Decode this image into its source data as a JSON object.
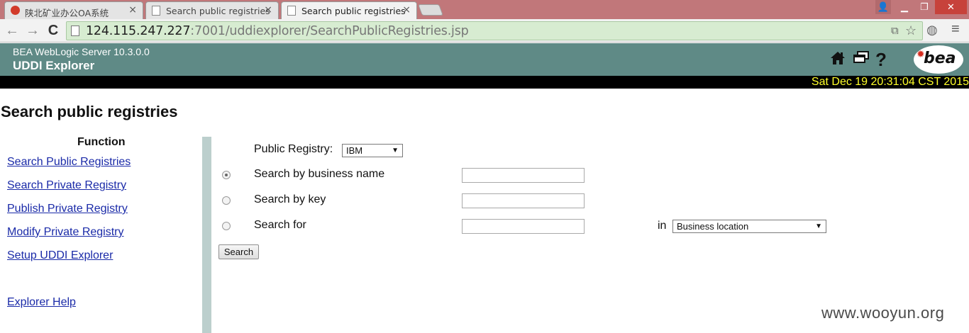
{
  "browser": {
    "tabs": [
      {
        "title": "陕北矿业办公OA系统",
        "close": "×"
      },
      {
        "title": "Search public registries",
        "close": "×"
      },
      {
        "title": "Search public registries",
        "close": "×",
        "active": true
      }
    ],
    "window_controls": {
      "minimize": "▁",
      "maximize": "❐",
      "close": "✕"
    },
    "toolbar": {
      "back": "←",
      "forward": "→",
      "reload": "C",
      "menu": "≡"
    },
    "url": {
      "host": "124.115.247.227",
      "rest": ":7001/uddiexplorer/SearchPublicRegistries.jsp"
    }
  },
  "header": {
    "product": "BEA WebLogic Server 10.3.0.0",
    "app": "UDDI Explorer",
    "icons": [
      "home-icon",
      "windows-icon",
      "help-icon"
    ],
    "logo_text": "bea",
    "datetime": "Sat Dec 19 20:31:04 CST 2015"
  },
  "page_title": "Search public registries",
  "sidebar": {
    "heading": "Function",
    "links": [
      "Search Public Registries",
      "Search Private Registry",
      "Publish Private Registry",
      "Modify Private Registry",
      "Setup UDDI Explorer",
      "Explorer Help"
    ]
  },
  "form": {
    "registry_label": "Public Registry:",
    "registry_value": "IBM",
    "options": [
      {
        "label": "Search by business name",
        "selected": true
      },
      {
        "label": "Search by key",
        "selected": false
      },
      {
        "label": "Search for",
        "selected": false
      }
    ],
    "in_label": "in",
    "location_value": "Business location",
    "search_button": "Search"
  },
  "watermark": "www.wooyun.org",
  "colors": {
    "header": "#5f8a86",
    "date_text": "#ffff2a",
    "link": "#1a2aa8",
    "divider": "#bccfcd"
  }
}
